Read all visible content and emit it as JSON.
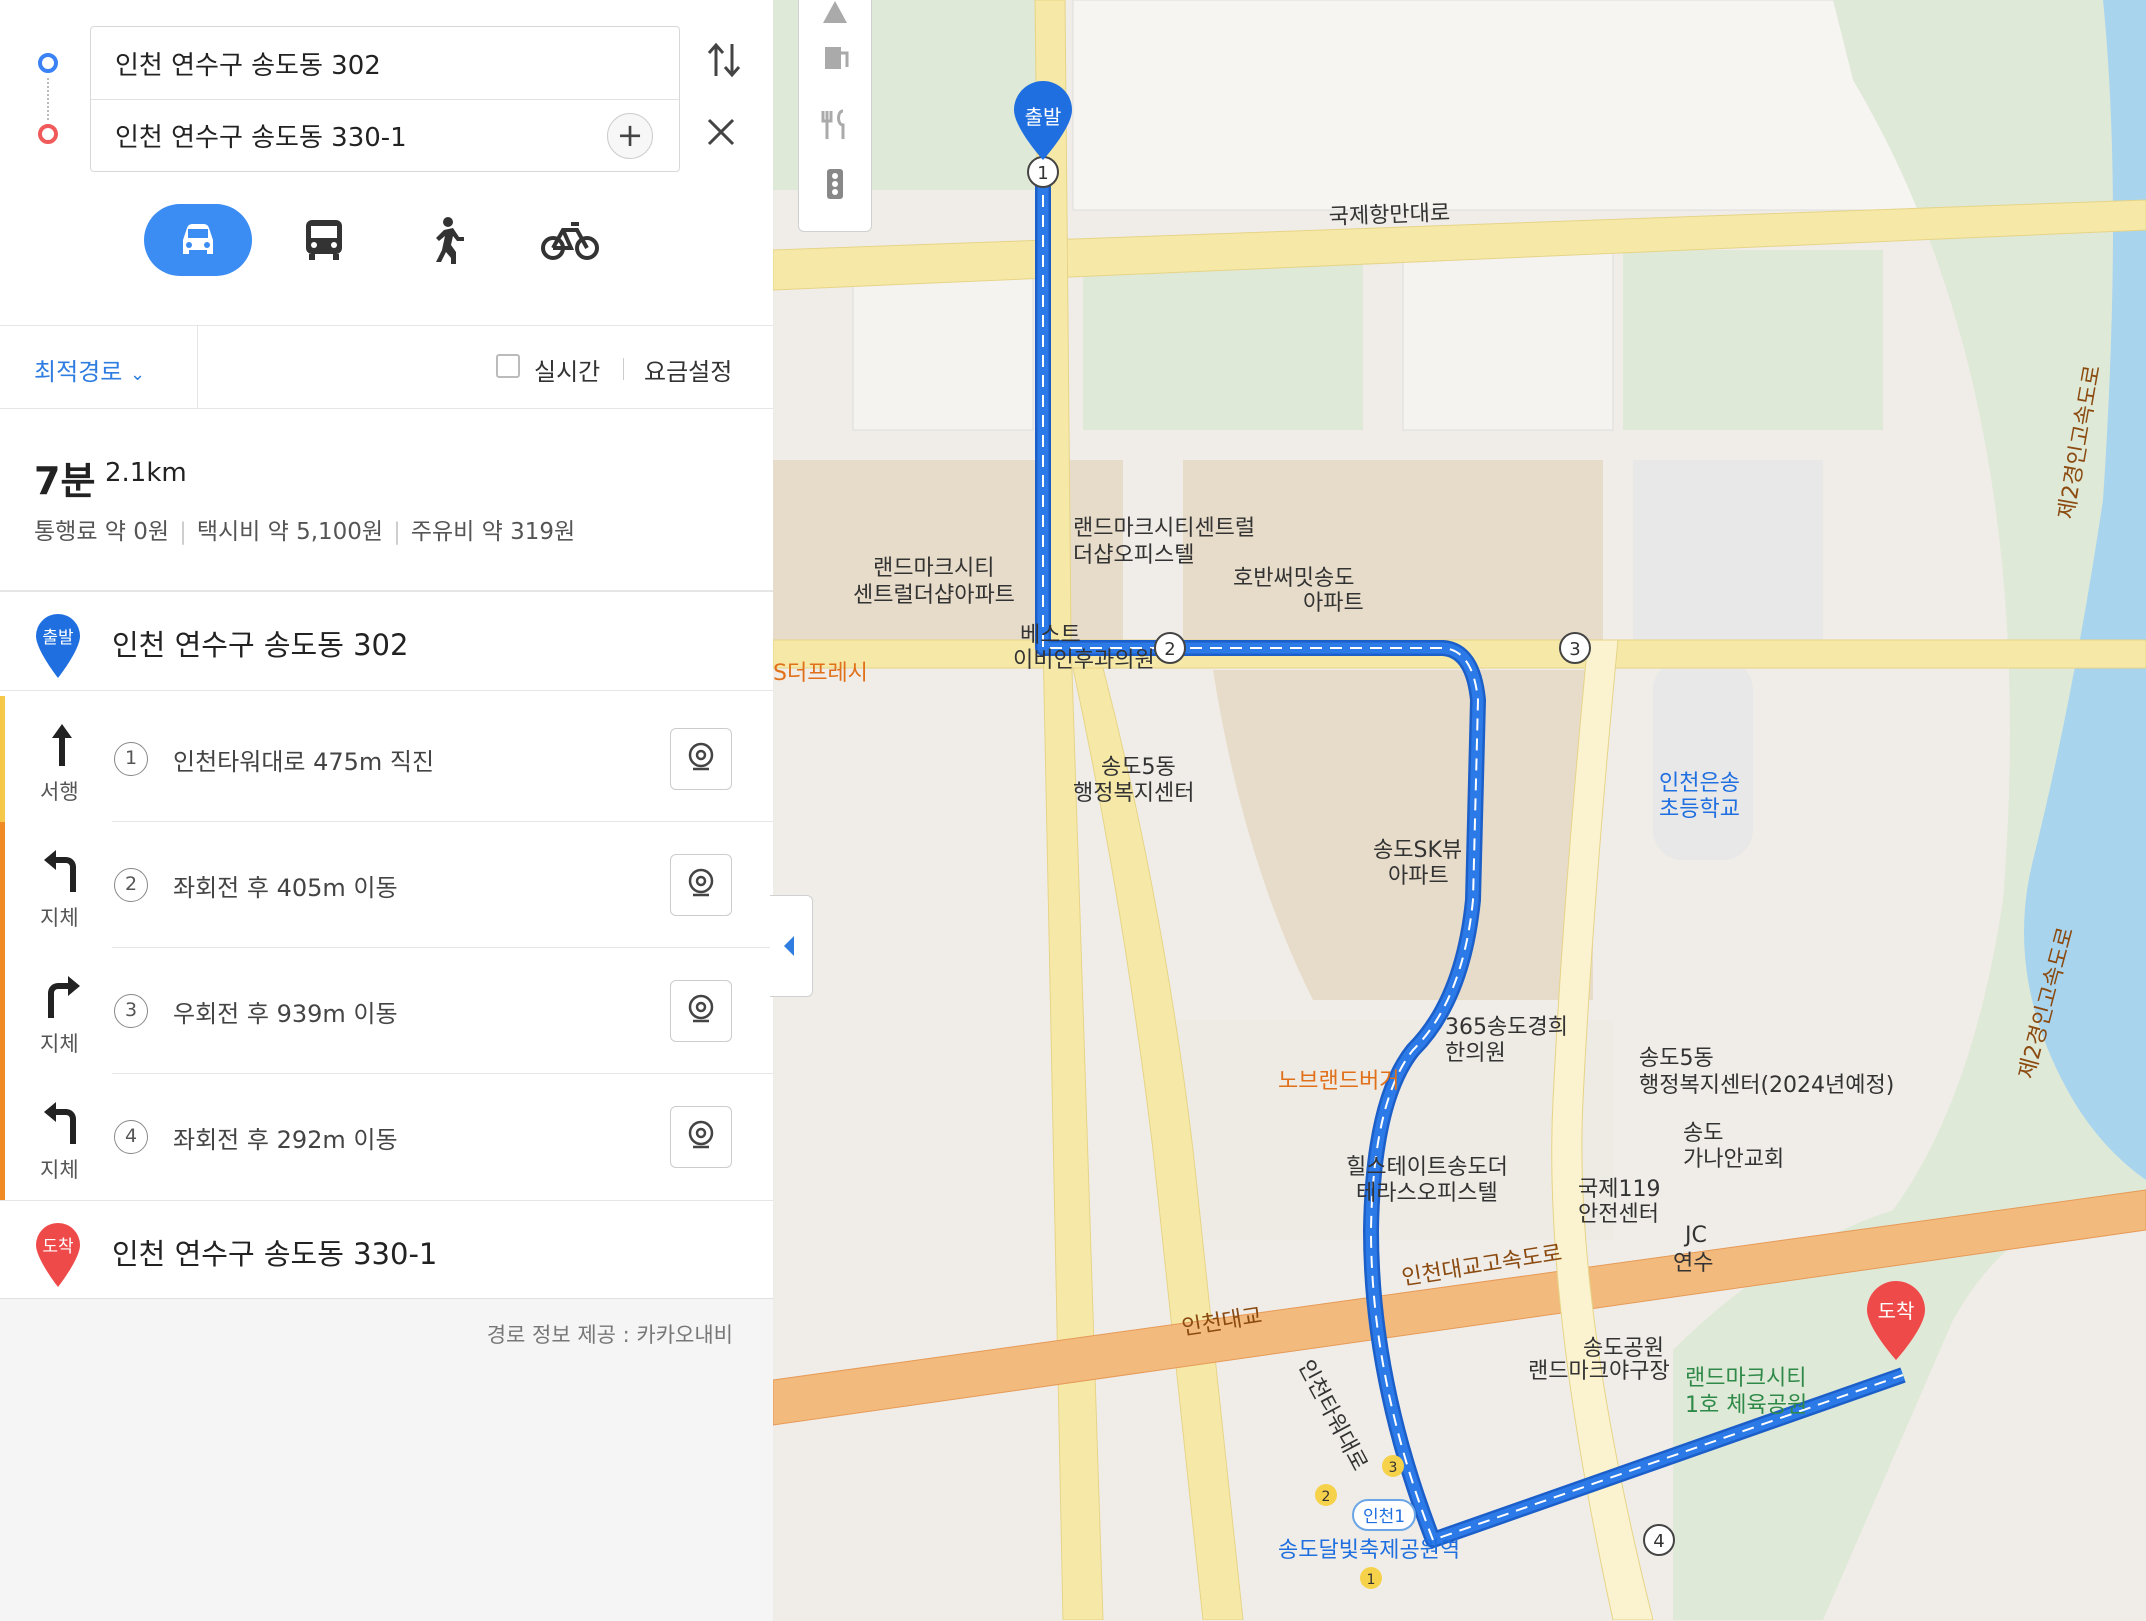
{
  "search": {
    "origin": "인천 연수구 송도동 302",
    "destination": "인천 연수구 송도동 330-1"
  },
  "modes": [
    {
      "name": "car",
      "active": true
    },
    {
      "name": "bus",
      "active": false
    },
    {
      "name": "walk",
      "active": false
    },
    {
      "name": "bike",
      "active": false
    }
  ],
  "options": {
    "route_type": "최적경로",
    "realtime": "실시간",
    "fee_settings": "요금설정"
  },
  "summary": {
    "time": "7분",
    "distance": "2.1km",
    "toll": "통행료 약 0원",
    "taxi": "택시비 약 5,100원",
    "fuel": "주유비 약 319원"
  },
  "start": {
    "badge": "출발",
    "name": "인천 연수구 송도동 302"
  },
  "steps": [
    {
      "num": "1",
      "label": "서행",
      "text": "인천타워대로 475m 직진",
      "direction": "straight",
      "color": "#f6c84a"
    },
    {
      "num": "2",
      "label": "지체",
      "text": "좌회전 후 405m 이동",
      "direction": "left",
      "color": "#f08a24"
    },
    {
      "num": "3",
      "label": "지체",
      "text": "우회전 후 939m 이동",
      "direction": "right",
      "color": "#f08a24"
    },
    {
      "num": "4",
      "label": "지체",
      "text": "좌회전 후 292m 이동",
      "direction": "left",
      "color": "#f08a24"
    }
  ],
  "end": {
    "badge": "도착",
    "name": "인천 연수구 송도동 330-1"
  },
  "credit": "경로 정보 제공 : 카카오내비",
  "map": {
    "pins": {
      "start": "출발",
      "end": "도착"
    },
    "waypoints": [
      "1",
      "2",
      "3",
      "4"
    ],
    "labels": {
      "road_top": "국제항만대로",
      "apt1": "랜드마크시티",
      "apt1b": "센트럴더샵아파트",
      "off1": "랜드마크시티센트럴",
      "off1b": "더샵오피스텔",
      "apt2": "호반써밋송도",
      "apt2b": "아파트",
      "clinic": "베스트",
      "clinicb": "이비인후과의원",
      "fresh": "S더프레시",
      "gov": "송도5동",
      "govb": "행정복지센터",
      "apt3": "송도SK뷰",
      "apt3b": "아파트",
      "school": "인천은송",
      "schoolb": "초등학교",
      "hanui": "365송도경희",
      "hanuib": "한의원",
      "burger": "노브랜드버거",
      "gov2": "송도5동",
      "gov2b": "행정복지센터(2024년예정)",
      "church": "송도",
      "churchb": "가나안교회",
      "hill": "힐스테이트송도더",
      "hillb": "테라스오피스텔",
      "fire": "국제119",
      "fireb": "안전센터",
      "expressway": "인천대교고속도로",
      "jc": "JC",
      "yeonsu": "연수",
      "bridge": "인천대교",
      "tower_road": "인천타워대로",
      "baseball": "송도공원",
      "baseballb": "랜드마크야구장",
      "park": "랜드마크시티",
      "parkb": "1호 체육공원",
      "highway2": "제2경인고속도로",
      "highway2b": "제2경인고속도로",
      "station_line": "인천1",
      "station": "송도달빛축제공원역",
      "exit1": "1",
      "exit2": "2",
      "exit3": "3"
    }
  },
  "colors": {
    "accent": "#3b8cf3",
    "route": "#2b7ae8",
    "start_pin": "#1f6fe0",
    "end_pin": "#ef4a4a",
    "slow": "#f6c84a",
    "congested": "#f08a24"
  }
}
